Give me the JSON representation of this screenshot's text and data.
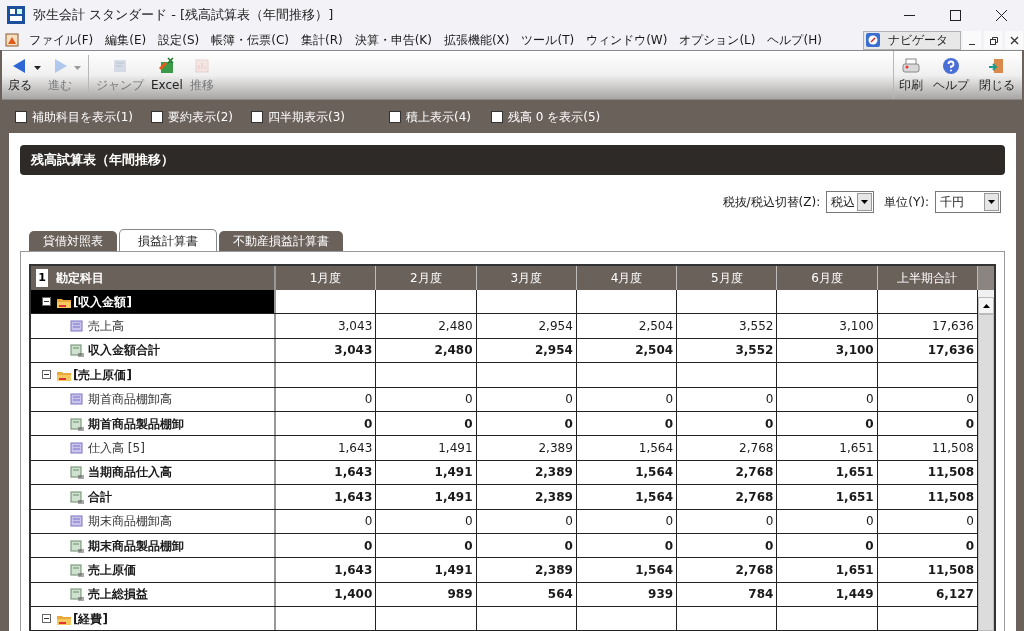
{
  "window": {
    "title": "弥生会計 スタンダード - [残高試算表（年間推移）]"
  },
  "menu": [
    "ファイル(F)",
    "編集(E)",
    "設定(S)",
    "帳簿・伝票(C)",
    "集計(R)",
    "決算・申告(K)",
    "拡張機能(X)",
    "ツール(T)",
    "ウィンドウ(W)",
    "オプション(L)",
    "ヘルプ(H)"
  ],
  "navigator": {
    "label": "ナビゲータ"
  },
  "toolbar": {
    "left": [
      {
        "kind": "back",
        "label": "戻る",
        "disabled": false,
        "dropdown": true
      },
      {
        "kind": "forward",
        "label": "進む",
        "disabled": true,
        "dropdown": true
      },
      {
        "kind": "jump",
        "label": "ジャンプ",
        "disabled": true,
        "dropdown": false
      },
      {
        "kind": "excel",
        "label": "Excel",
        "disabled": false,
        "dropdown": false
      },
      {
        "kind": "trend",
        "label": "推移",
        "disabled": true,
        "dropdown": false
      }
    ],
    "right": [
      {
        "kind": "print",
        "label": "印刷",
        "disabled": false,
        "dropdown": false
      },
      {
        "kind": "help",
        "label": "ヘルプ",
        "disabled": false,
        "dropdown": false
      },
      {
        "kind": "close",
        "label": "閉じる",
        "disabled": false,
        "dropdown": false
      }
    ]
  },
  "options": [
    {
      "label": "補助科目を表示(1)",
      "checked": false
    },
    {
      "label": "要約表示(2)",
      "checked": false
    },
    {
      "label": "四半期表示(3)",
      "checked": false
    },
    {
      "label": "積上表示(4)",
      "checked": false
    },
    {
      "label": "残高 0 を表示(5)",
      "checked": false
    }
  ],
  "panel_title": "残高試算表（年間推移）",
  "tax_select": {
    "label": "税抜/税込切替(Z):",
    "value": "税込"
  },
  "unit_select": {
    "label": "単位(Y):",
    "value": "千円"
  },
  "tabs": [
    {
      "label": "貸借対照表",
      "selected": false
    },
    {
      "label": "損益計算書",
      "selected": true
    },
    {
      "label": "不動産損益計算書",
      "selected": false
    }
  ],
  "table": {
    "corner": "1",
    "columns": [
      "勘定科目",
      "1月度",
      "2月度",
      "3月度",
      "4月度",
      "5月度",
      "6月度",
      "上半期合計"
    ],
    "rows": [
      {
        "kind": "group",
        "label": "[収入金額]",
        "selected": true,
        "values": []
      },
      {
        "kind": "account",
        "label": "売上高",
        "selected": false,
        "values": [
          "3,043",
          "2,480",
          "2,954",
          "2,504",
          "3,552",
          "3,100",
          "17,636"
        ]
      },
      {
        "kind": "total",
        "label": "収入金額合計",
        "selected": false,
        "values": [
          "3,043",
          "2,480",
          "2,954",
          "2,504",
          "3,552",
          "3,100",
          "17,636"
        ]
      },
      {
        "kind": "group",
        "label": "[売上原価]",
        "selected": false,
        "values": []
      },
      {
        "kind": "account",
        "label": "期首商品棚卸高",
        "selected": false,
        "values": [
          "0",
          "0",
          "0",
          "0",
          "0",
          "0",
          "0"
        ]
      },
      {
        "kind": "total",
        "label": "期首商品製品棚卸",
        "selected": false,
        "values": [
          "0",
          "0",
          "0",
          "0",
          "0",
          "0",
          "0"
        ]
      },
      {
        "kind": "account",
        "label": "仕入高 [5]",
        "selected": false,
        "values": [
          "1,643",
          "1,491",
          "2,389",
          "1,564",
          "2,768",
          "1,651",
          "11,508"
        ]
      },
      {
        "kind": "total",
        "label": "当期商品仕入高",
        "selected": false,
        "values": [
          "1,643",
          "1,491",
          "2,389",
          "1,564",
          "2,768",
          "1,651",
          "11,508"
        ]
      },
      {
        "kind": "total",
        "label": "合計",
        "selected": false,
        "values": [
          "1,643",
          "1,491",
          "2,389",
          "1,564",
          "2,768",
          "1,651",
          "11,508"
        ]
      },
      {
        "kind": "account",
        "label": "期末商品棚卸高",
        "selected": false,
        "values": [
          "0",
          "0",
          "0",
          "0",
          "0",
          "0",
          "0"
        ]
      },
      {
        "kind": "total",
        "label": "期末商品製品棚卸",
        "selected": false,
        "values": [
          "0",
          "0",
          "0",
          "0",
          "0",
          "0",
          "0"
        ]
      },
      {
        "kind": "total",
        "label": "売上原価",
        "selected": false,
        "values": [
          "1,643",
          "1,491",
          "2,389",
          "1,564",
          "2,768",
          "1,651",
          "11,508"
        ]
      },
      {
        "kind": "total",
        "label": "売上総損益",
        "selected": false,
        "values": [
          "1,400",
          "989",
          "564",
          "939",
          "784",
          "1,449",
          "6,127"
        ]
      },
      {
        "kind": "group",
        "label": "[経費]",
        "selected": false,
        "values": []
      }
    ]
  }
}
